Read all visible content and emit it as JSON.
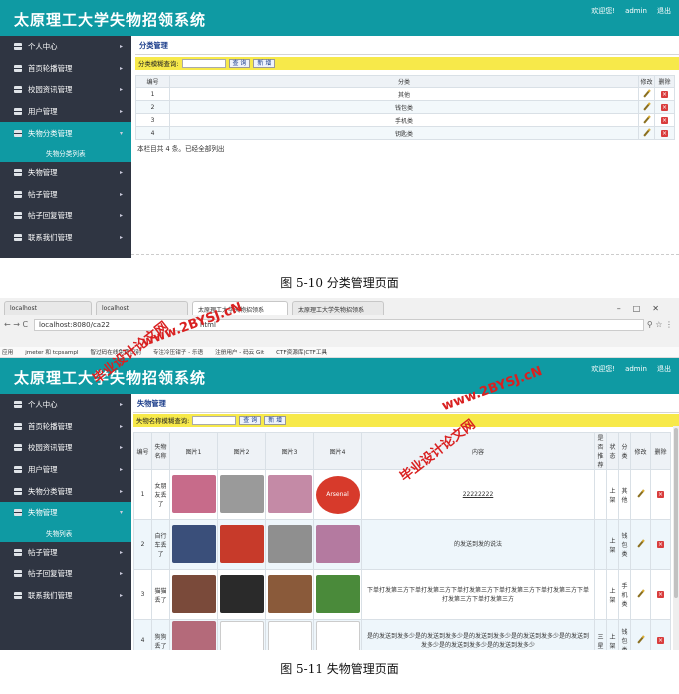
{
  "app": {
    "title": "太原理工大学失物招领系统",
    "welcome": "欢迎您!",
    "user": "admin",
    "logout": "退出"
  },
  "menu": [
    {
      "label": "个人中心"
    },
    {
      "label": "首页轮播管理"
    },
    {
      "label": "校园资讯管理"
    },
    {
      "label": "用户管理"
    },
    {
      "label": "失物分类管理"
    },
    {
      "label": "失物管理"
    },
    {
      "label": "帖子管理"
    },
    {
      "label": "帖子回复管理"
    },
    {
      "label": "联系我们管理"
    }
  ],
  "shot1": {
    "page_title": "分类管理",
    "search_label": "分类模糊查询:",
    "query_button": "查 询",
    "add_button": "新 增",
    "submenu": "失物分类列表",
    "headers": [
      "编号",
      "分类",
      "修改",
      "删除"
    ],
    "rows": [
      [
        "1",
        "其他"
      ],
      [
        "2",
        "钱包类"
      ],
      [
        "3",
        "手机类"
      ],
      [
        "4",
        "钥匙类"
      ]
    ],
    "footer": "本栏目共 4 条。已经全部列出",
    "caption": "图 5-10 分类管理页面"
  },
  "browser": {
    "tabs": [
      "localhost",
      "localhost",
      "太原理工大学失物招领系",
      "太原理工大学失物招领系"
    ],
    "url": "localhost:8080/ca22",
    "url_tail": "html",
    "bookmarks": [
      "应用",
      "jmeter 和 tcpsampl",
      "智过码在线免费识别",
      "专注冷压钳子 - 乐语",
      "注册用户 - 码云 Git",
      "CTF资源库|CTF工具"
    ]
  },
  "shot2": {
    "page_title": "失物管理",
    "search_label": "失物名称模糊查询:",
    "query_button": "查 询",
    "add_button": "新 增",
    "submenu": "失物列表",
    "headers": [
      "编号",
      "失物名称",
      "图片1",
      "图片2",
      "图片3",
      "图片4",
      "内容",
      "是否推荐",
      "状态",
      "分类",
      "修改",
      "删除"
    ],
    "rows": [
      {
        "id": "1",
        "name": "女朋友丢了",
        "content": "22222222",
        "rec": "",
        "state": "上架",
        "cat": "其他"
      },
      {
        "id": "2",
        "name": "自行车丢了",
        "content": "的发送到发的说法",
        "rec": "",
        "state": "上架",
        "cat": "钱包类"
      },
      {
        "id": "3",
        "name": "猫猫丢了",
        "content": "下单打发第三方下单打发第三方下单打发第三方下单打发第三方下单打发第三方下单打发第三方下单打发第三方",
        "rec": "",
        "state": "上架",
        "cat": "手机类"
      },
      {
        "id": "4",
        "name": "狗狗丢了",
        "content": "是的发送到发多少是的发送到发多少是的发送到发多少是的发送到发多少是的发送到发多少是的发送到发多少是的发送到发多少",
        "rec": "三星",
        "state": "上架",
        "cat": "钱包类"
      }
    ],
    "arsenal": "Arsenal",
    "caption": "图 5-11 失物管理页面"
  },
  "watermarks": [
    "毕业设计论文网",
    "www.2BYSJ.cN"
  ],
  "colors": {
    "header": "#0f9aa3",
    "sidebar": "#2f3542",
    "search_bar": "#f7e94a",
    "watermark": "#d92020"
  }
}
